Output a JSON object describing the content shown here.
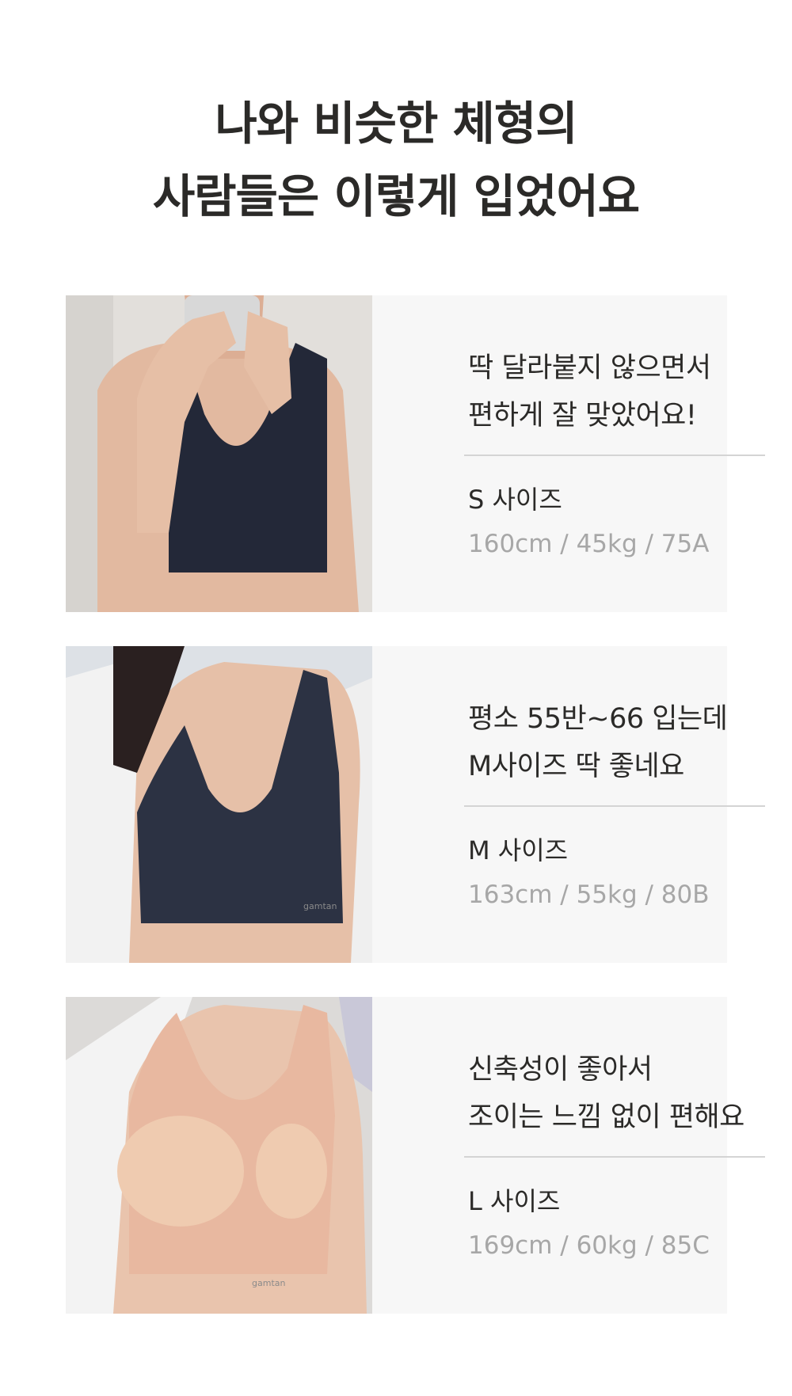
{
  "headline": {
    "line1": "나와 비슷한 체형의",
    "line2": "사람들은 이렇게 입었어요"
  },
  "reviews": [
    {
      "quote_line1": "딱 달라붙지 않으면서",
      "quote_line2": "편하게 잘 맞았어요!",
      "size": "S 사이즈",
      "spec": "160cm / 45kg / 75A",
      "garment_color": "#232838"
    },
    {
      "quote_line1": "평소 55반~66 입는데",
      "quote_line2": "M사이즈 딱 좋네요",
      "size": "M 사이즈",
      "spec": "163cm / 55kg / 80B",
      "garment_color": "#2c3243",
      "brand_mark": "gamtan"
    },
    {
      "quote_line1": "신축성이 좋아서",
      "quote_line2": "조이는 느낌 없이 편해요",
      "size": "L 사이즈",
      "spec": "169cm / 60kg / 85C",
      "garment_color": "#e8b8a0",
      "brand_mark": "gamtan"
    }
  ],
  "colors": {
    "text_dark": "#2b2a28",
    "text_muted": "#a7a7a7",
    "card_bg": "#f7f7f7",
    "divider": "#d4d4d4"
  }
}
